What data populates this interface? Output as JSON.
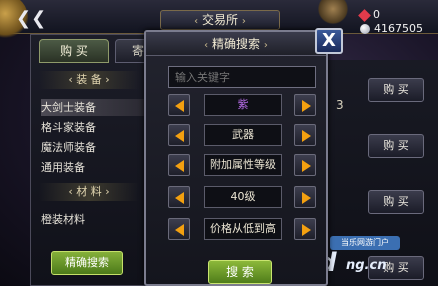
{
  "header": {
    "title": "交易所",
    "arrow_left": "‹",
    "arrow_right": "›",
    "back_glyph": "❮❮"
  },
  "currency": {
    "gems": "0",
    "coins": "4167505"
  },
  "tabs": {
    "buy": "购 买",
    "sell": "寄"
  },
  "sidebar": {
    "equipment_header": "‹ 装  备 ›",
    "equipment_items": [
      "大剑士装备",
      "格斗家装备",
      "魔法师装备",
      "通用装备"
    ],
    "material_header": "‹ 材  料 ›",
    "material_items": [
      "橙装材料"
    ],
    "precise_search_button": "精确搜索"
  },
  "listing": {
    "buy_labels": [
      "购 买",
      "购 买",
      "购 买",
      "购 买"
    ],
    "partial_number": "3"
  },
  "dialog": {
    "title": "精确搜索",
    "arrow_left": "‹",
    "arrow_right": "›",
    "close_label": "X",
    "keyword_placeholder": "输入关键字",
    "filters": [
      {
        "value": "紫"
      },
      {
        "value": "武器"
      },
      {
        "value": "附加属性等级"
      },
      {
        "value": "40级"
      },
      {
        "value": "价格从低到高"
      }
    ],
    "search_button": "搜 索"
  },
  "watermark": {
    "site_name": "当乐网游门户",
    "logo_d": "d",
    "logo_url": "ng.cn"
  },
  "colors": {
    "accent_orange": "#f3a010",
    "green_button": "#6c9a2a",
    "quality_purple": "#b56ce6"
  }
}
